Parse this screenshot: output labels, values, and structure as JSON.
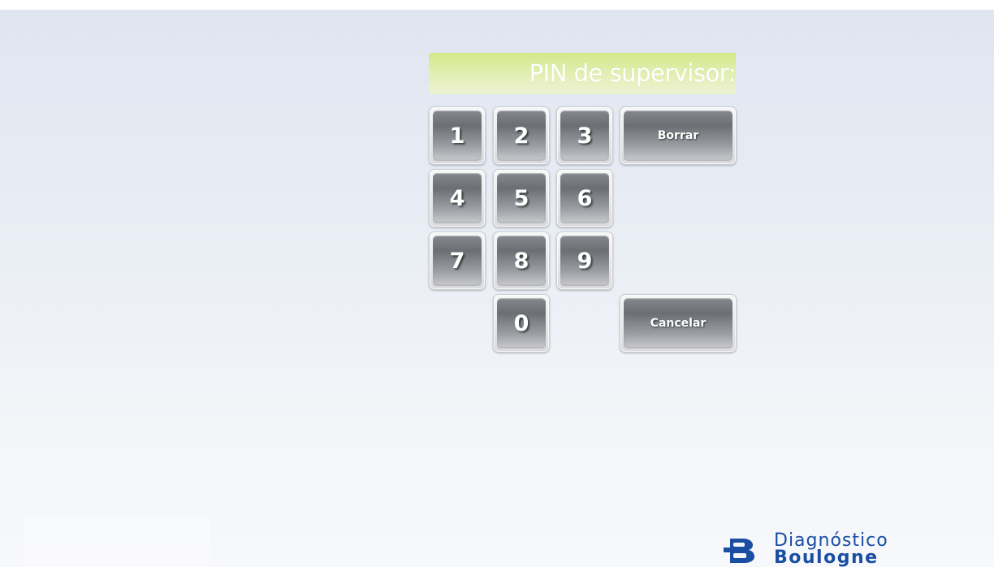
{
  "pin_prompt": {
    "title": "PIN de supervisor:"
  },
  "keypad": {
    "digits": [
      "1",
      "2",
      "3",
      "4",
      "5",
      "6",
      "7",
      "8",
      "9",
      "0"
    ],
    "clear_label": "Borrar",
    "cancel_label": "Cancelar"
  },
  "brand": {
    "line1": "Diagnóstico",
    "line2": "Boulogne"
  },
  "colors": {
    "header_accent": "#d3e88a",
    "key_face": "#6b6f74",
    "brand_blue": "#1a4ea3"
  },
  "icons": {
    "brand_logo": "diagnostico-boulogne-logo-icon"
  }
}
